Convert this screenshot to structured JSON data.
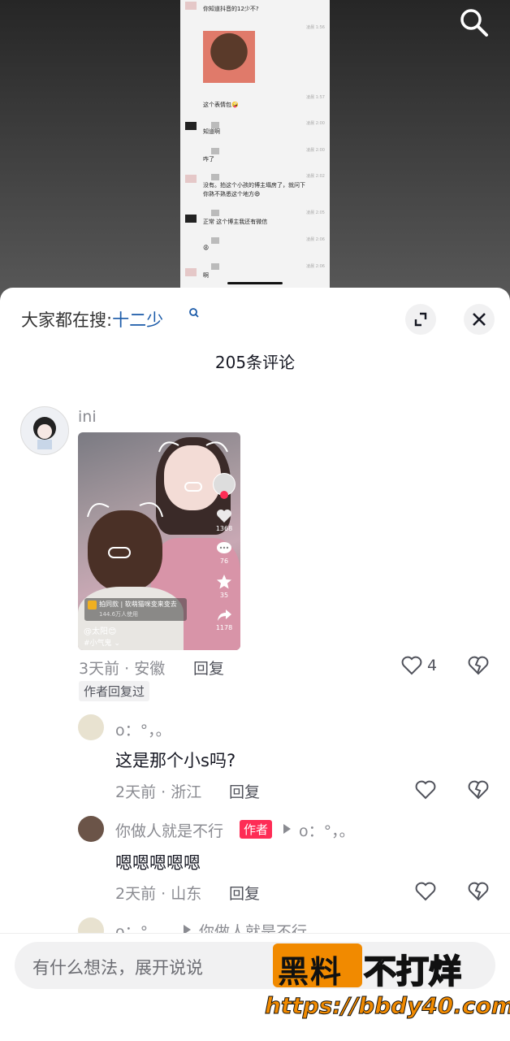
{
  "video": {
    "chat": [
      {
        "text": "你知道抖音的12少不?",
        "time": ""
      },
      {
        "text": "这个表情包🤪",
        "time": "凌晨 1:57"
      },
      {
        "text": "知道啊",
        "time": "凌晨 2:00"
      },
      {
        "text": "咋了",
        "time": "凌晨 2:00"
      },
      {
        "text": "没有。拍这个小孩的博主塌房了，就问下",
        "text2": "你熟不熟悉这个地方😄",
        "time": "凌晨 2:02"
      },
      {
        "text": "正常 这个博主我还有微信",
        "time": "凌晨 2:05"
      },
      {
        "text": "😩",
        "time": "凌晨 2:06"
      },
      {
        "text": "啊",
        "time": "凌晨 2:06"
      }
    ],
    "search_icon": "search-icon"
  },
  "header": {
    "hot_prefix": "大家都在搜:",
    "hot_term": "十二少",
    "comment_count": "205条评论",
    "expand_icon": "expand-icon",
    "close_icon": "close-icon"
  },
  "comments": [
    {
      "username": "ini",
      "card": {
        "promo": "拍同款 | 软萌猫咪变来变去",
        "promo_sub": "144.6万人使用",
        "at": "@太阳😊",
        "tag": "#小气鬼 ⌄",
        "likes": "1368",
        "comments": "76",
        "favs": "35",
        "shares": "1178"
      },
      "meta": "3天前 · 安徽",
      "reply": "回复",
      "likes": "4",
      "author_replied": "作者回复过"
    },
    {
      "username": "o：°，。",
      "text": "这是那个小s吗?",
      "meta": "2天前 · 浙江",
      "reply": "回复"
    },
    {
      "username": "你做人就是不行",
      "badge": "作者",
      "reply_to": "o：°，。",
      "text": "嗯嗯嗯嗯嗯",
      "meta": "2天前 · 山东",
      "reply": "回复"
    },
    {
      "username": "o：°，。",
      "reply_to": "你做人就是不行"
    }
  ],
  "input": {
    "placeholder": "有什么想法，展开说说"
  },
  "watermark": {
    "part1": "黑料",
    "part2": "不打烊",
    "url": "https://bbdy40.com"
  }
}
